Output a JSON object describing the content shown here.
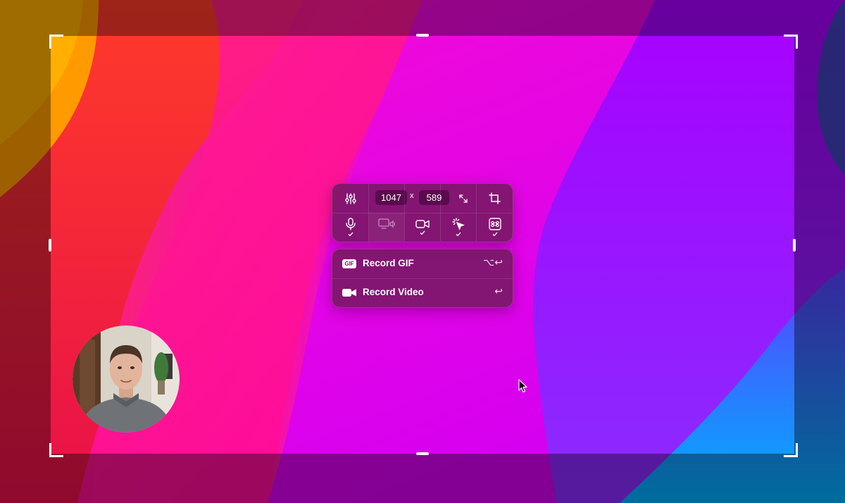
{
  "selection": {
    "width": "1047",
    "height": "589",
    "times_sign": "x"
  },
  "toolbar": {
    "settings_icon": "sliders-icon",
    "expand_icon": "expand-icon",
    "crop_icon": "crop-icon",
    "tools": [
      {
        "icon": "microphone-icon",
        "checked": true
      },
      {
        "icon": "system-audio-icon",
        "checked": false
      },
      {
        "icon": "camera-icon",
        "checked": true
      },
      {
        "icon": "click-highlight-icon",
        "checked": true
      },
      {
        "icon": "keystroke-icon",
        "checked": true
      }
    ]
  },
  "record_menu": {
    "gif": {
      "badge": "GIF",
      "label": "Record GIF",
      "shortcut": "⌥↩"
    },
    "video": {
      "icon": "video-camera-icon",
      "label": "Record Video",
      "shortcut": "↩"
    }
  },
  "colors": {
    "panel": "#761862",
    "wallpaper_magenta": "#f00ac8",
    "wallpaper_purple": "#8a00ff",
    "wallpaper_orange": "#ff8a00",
    "wallpaper_cyan": "#00aaff"
  }
}
